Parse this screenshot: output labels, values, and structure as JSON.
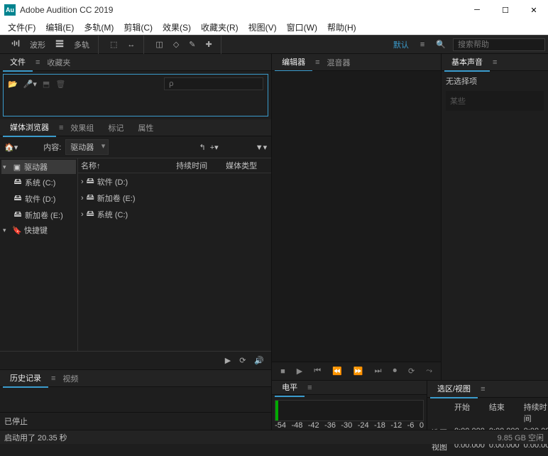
{
  "window": {
    "title": "Adobe Audition CC 2019"
  },
  "menu": {
    "file": "文件(F)",
    "edit": "编辑(E)",
    "multitrack": "多轨(M)",
    "clip": "剪辑(C)",
    "effects": "效果(S)",
    "favorites": "收藏夹(R)",
    "view": "视图(V)",
    "window": "窗口(W)",
    "help": "帮助(H)"
  },
  "toolbar": {
    "waveform": "波形",
    "multitrack": "多轨",
    "default_ws": "默认",
    "search_placeholder": "搜索帮助"
  },
  "panels": {
    "files": {
      "tab": "文件",
      "favorites_tab": "收藏夹",
      "search_placeholder": "ρ"
    },
    "media": {
      "tab": "媒体浏览器",
      "effects_tab": "效果组",
      "markers_tab": "标记",
      "props_tab": "属性",
      "content_label": "内容:",
      "content_value": "驱动器",
      "cols": {
        "name": "名称↑",
        "duration": "持续时间",
        "type": "媒体类型"
      },
      "tree": [
        {
          "label": "驱动器",
          "open": true
        },
        {
          "label": "系统 (C:)",
          "indent": 1
        },
        {
          "label": "软件 (D:)",
          "indent": 1
        },
        {
          "label": "新加卷 (E:)",
          "indent": 1
        },
        {
          "label": "快捷键",
          "open": true
        }
      ],
      "list": [
        {
          "label": "软件 (D:)"
        },
        {
          "label": "新加卷 (E:)"
        },
        {
          "label": "系统 (C:)"
        }
      ]
    },
    "history": {
      "tab": "历史记录",
      "video_tab": "视频"
    },
    "editor": {
      "tab": "编辑器",
      "mixer_tab": "混音器"
    },
    "sound": {
      "tab": "基本声音",
      "no_sel": "无选择项",
      "prompt": "某些"
    },
    "level": {
      "tab": "电平"
    },
    "sel": {
      "tab": "选区/视图",
      "start": "开始",
      "end": "结束",
      "dur": "持续时间",
      "row1": "选区",
      "row2": "视图",
      "v": "0:00.000"
    }
  },
  "level_scale": [
    "-54",
    "-48",
    "-42",
    "-36",
    "-30",
    "-24",
    "-18",
    "-12",
    "-6",
    "0"
  ],
  "status": {
    "left": "已停止",
    "started": "启动用了 20.35 秒",
    "free": "9.85 GB 空闲"
  }
}
